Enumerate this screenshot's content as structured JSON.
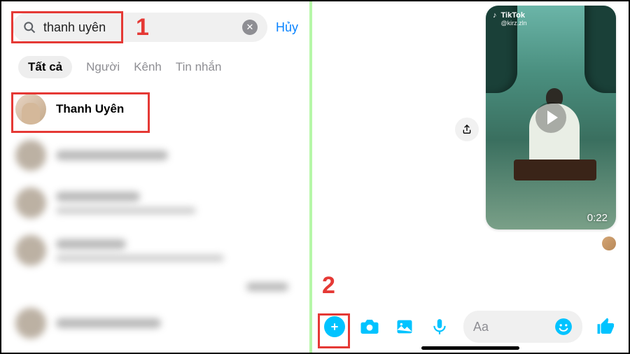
{
  "search": {
    "query": "thanh uyên",
    "clear_symbol": "✕",
    "cancel_label": "Hủy"
  },
  "tabs": {
    "all": "Tất cả",
    "people": "Người",
    "channels": "Kênh",
    "messages": "Tin nhắn"
  },
  "results": {
    "top": {
      "name": "Thanh Uyên"
    }
  },
  "callouts": {
    "one": "1",
    "two": "2"
  },
  "video": {
    "platform": "TikTok",
    "handle": "@kirz.zln",
    "duration": "0:22"
  },
  "composer": {
    "placeholder": "Aa"
  }
}
